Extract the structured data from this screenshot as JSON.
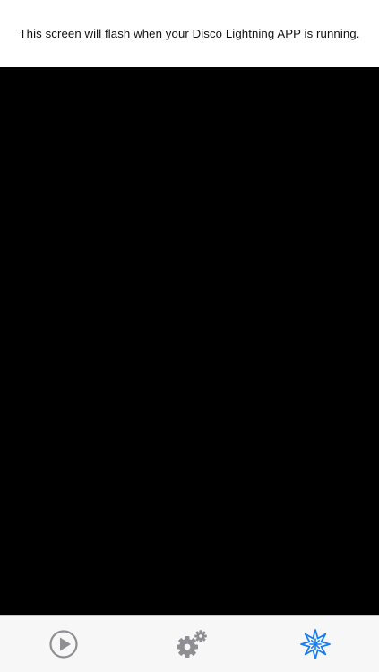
{
  "header": {
    "message": "This screen will flash when your Disco Lightning APP is running."
  },
  "flash_area": {
    "color": "#000000"
  },
  "tabbar": {
    "active_color": "#1a7ef5",
    "inactive_color": "#8e8e93",
    "tabs": [
      {
        "icon": "play-icon",
        "active": false
      },
      {
        "icon": "gears-icon",
        "active": false
      },
      {
        "icon": "flash-burst-icon",
        "active": true
      }
    ]
  }
}
